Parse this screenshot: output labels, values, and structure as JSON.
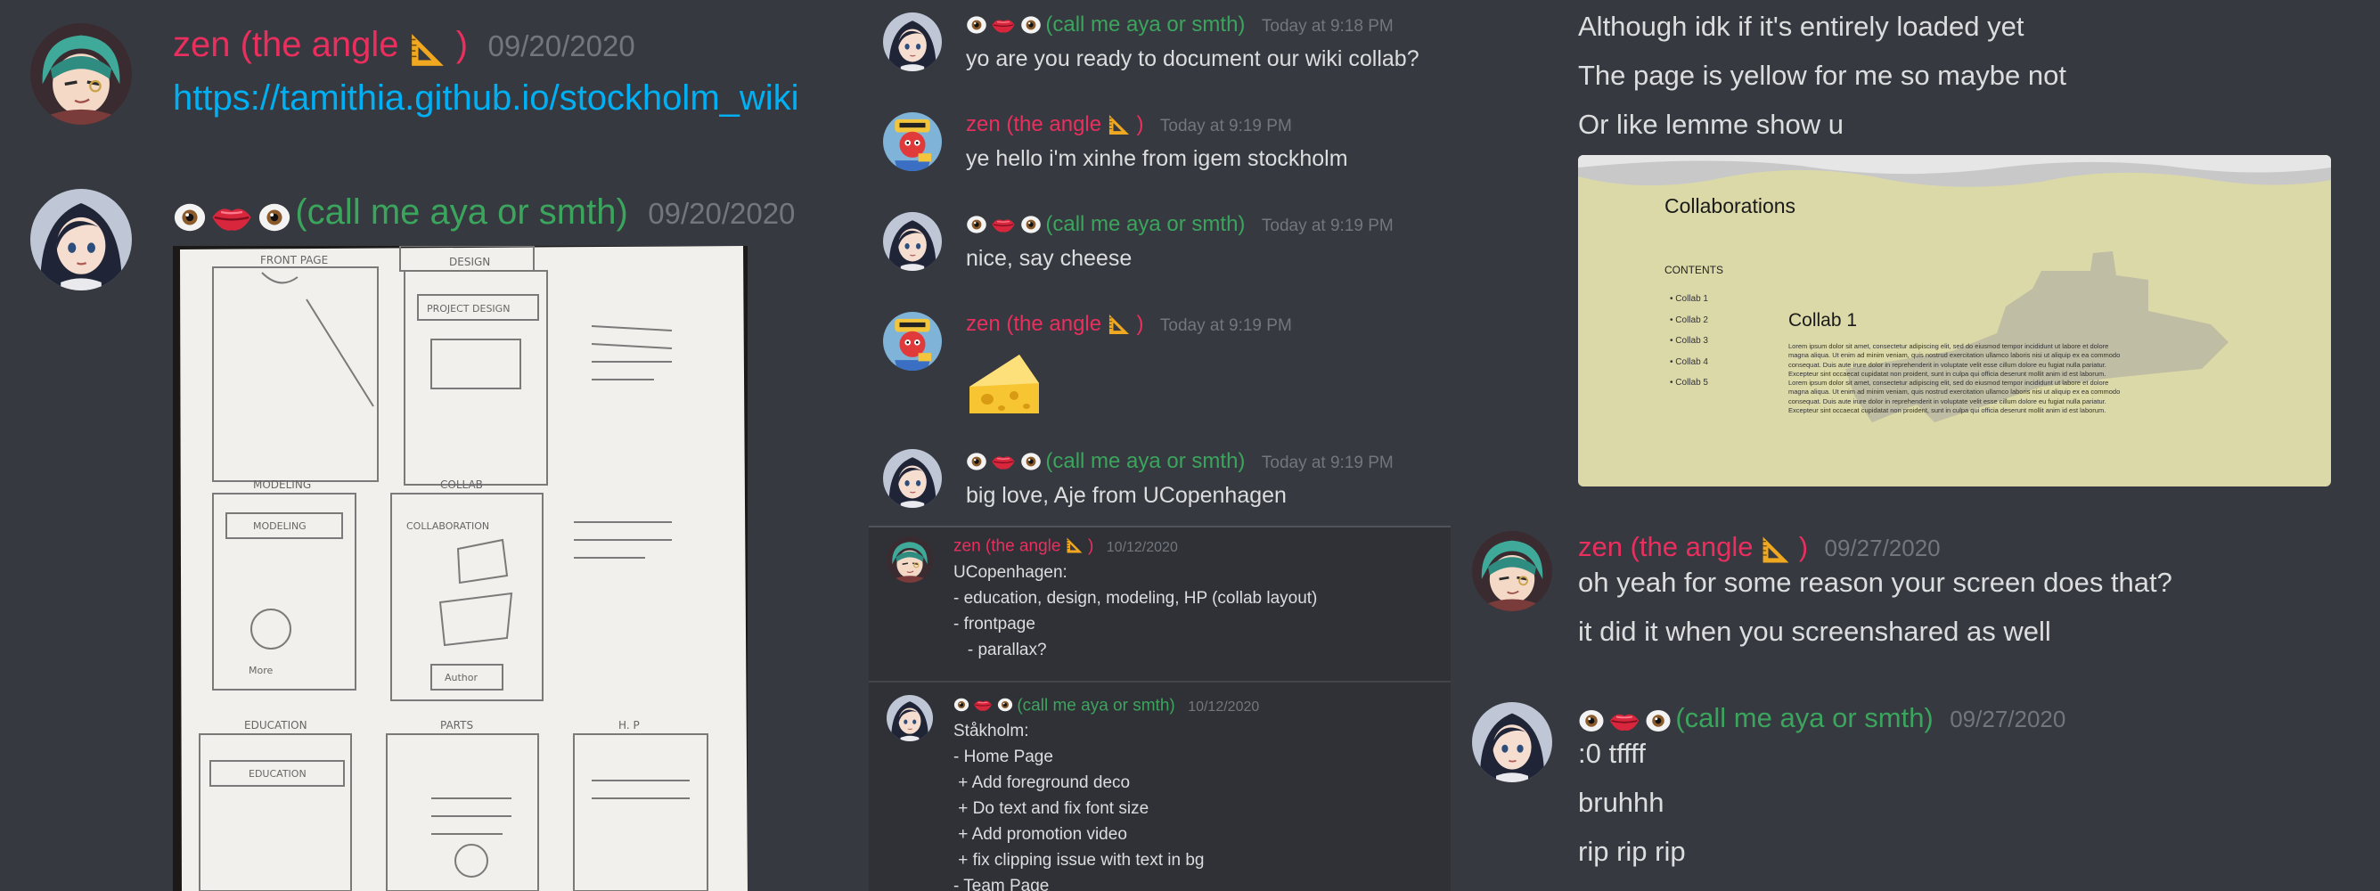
{
  "users": {
    "zen": "zen (the angle 📐)",
    "zen_plain": "zen (the angle",
    "aya_suffix": "(call me aya or smth)"
  },
  "left": {
    "msg1": {
      "time": "09/20/2020",
      "link": "https://tamithia.github.io/stockholm_wiki"
    },
    "msg2": {
      "time": "09/20/2020"
    }
  },
  "sketch": {
    "labels": [
      "FRONT PAGE",
      "DESIGN",
      "MODELING",
      "COLLAB",
      "EDUCATION",
      "PARTS",
      "H. P"
    ],
    "boxes": [
      "PROJECT DESIGN",
      "MODELING",
      "COLLABORATION",
      "EDUCATION"
    ],
    "small": [
      "Author",
      "More"
    ]
  },
  "mid_top": {
    "m1": {
      "time": "Today at 9:18 PM",
      "text": "yo are you ready to document our wiki collab?"
    },
    "m2": {
      "time": "Today at 9:19 PM",
      "text": "ye hello i'm xinhe from igem stockholm"
    },
    "m3": {
      "time": "Today at 9:19 PM",
      "text": "nice, say cheese"
    },
    "m4": {
      "time": "Today at 9:19 PM"
    },
    "m5": {
      "time": "Today at 9:19 PM",
      "text": "big love, Aje from UCopenhagen"
    }
  },
  "mid_bottom": {
    "m1": {
      "time": "10/12/2020",
      "lines": [
        "UCopenhagen:",
        "- education, design, modeling, HP (collab layout)",
        "- frontpage",
        "   - parallax?"
      ]
    },
    "m2": {
      "time": "10/12/2020",
      "lines": [
        "Ståkholm:",
        "- Home Page",
        " + Add foreground deco",
        " + Do text and fix font size",
        " + Add promotion video",
        " + fix clipping issue with text in bg",
        "- Team Page"
      ]
    }
  },
  "right": {
    "top_lines": [
      "Although idk if it's entirely loaded yet",
      "The page is yellow for me so maybe not",
      "Or like lemme show u"
    ],
    "embed": {
      "title": "Collaborations",
      "contents_label": "CONTENTS",
      "toc": [
        "Collab 1",
        "Collab 2",
        "Collab 3",
        "Collab 4",
        "Collab 5"
      ],
      "section_title": "Collab 1",
      "lorem": [
        "Lorem ipsum dolor sit amet, consectetur adipiscing elit, sed do eiusmod tempor incididunt ut labore et dolore",
        "magna aliqua. Ut enim ad minim veniam, quis nostrud exercitation ullamco laboris nisi ut aliquip ex ea commodo",
        "consequat. Duis aute irure dolor in reprehenderit in voluptate velit esse cillum dolore eu fugiat nulla pariatur.",
        "Excepteur sint occaecat cupidatat non proident, sunt in culpa qui officia deserunt mollit anim id est laborum.",
        "Lorem ipsum dolor sit amet, consectetur adipiscing elit, sed do eiusmod tempor incididunt ut labore et dolore",
        "magna aliqua. Ut enim ad minim veniam, quis nostrud exercitation ullamco laboris nisi ut aliquip ex ea commodo",
        "consequat. Duis aute irure dolor in reprehenderit in voluptate velit esse cillum dolore eu fugiat nulla pariatur.",
        "Excepteur sint occaecat cupidatat non proident, sunt in culpa qui officia deserunt mollit anim id est laborum."
      ]
    },
    "m1": {
      "time": "09/27/2020",
      "lines": [
        "oh yeah for some reason your screen does that?",
        "it did it when you screenshared as well"
      ]
    },
    "m2": {
      "time": "09/27/2020",
      "lines": [
        ":0 tffff",
        "bruhhh",
        "rip rip rip"
      ]
    }
  },
  "icons": [
    "eye-icon",
    "lips-icon",
    "triangle-ruler-icon",
    "cheese-icon"
  ],
  "colors": {
    "zen": "#ea2f5f",
    "aya": "#3ba55d",
    "link": "#00b0f4",
    "timestamp": "#72767d",
    "bg": "#36393f"
  }
}
